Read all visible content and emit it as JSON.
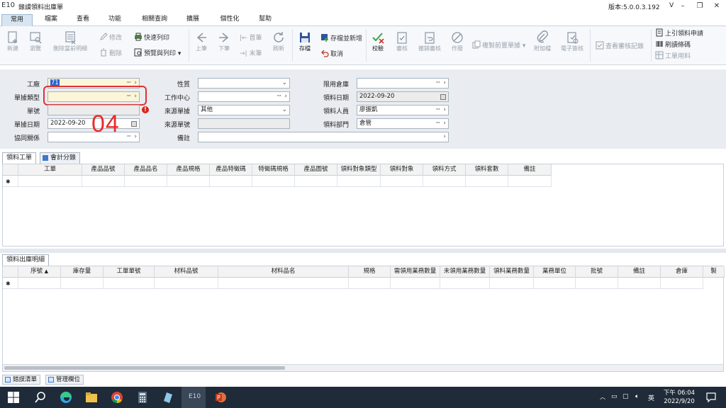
{
  "window": {
    "logo": "E10",
    "title": "錄謨領料出庫單",
    "version": "版本:5.0.0.3.192",
    "version_suffix": "V",
    "controls": [
      "–",
      "❐",
      "✕"
    ]
  },
  "menu": {
    "tabs": [
      "常用",
      "檔案",
      "查看",
      "功能",
      "相關查詢",
      "擴展",
      "個性化",
      "幫助"
    ],
    "active": "常用"
  },
  "ribbon": {
    "new": "新建",
    "browse": "瀏覽",
    "delete_detail": "刪除當前明細",
    "modify": "修改",
    "delete": "刪除",
    "quick_print": "快速列印",
    "preview_print": "預覽與列印",
    "prev": "上筆",
    "next": "下筆",
    "first": "首筆",
    "last": "末筆",
    "refresh": "刷新",
    "save": "存檔",
    "save_new": "存檔並新增",
    "cancel": "取消",
    "verify": "校驗",
    "approve": "審核",
    "unapprove": "撤銷審核",
    "void": "作廢",
    "copy_prev": "複製前置單據",
    "attachment": "附加檔",
    "e_sign": "電子簽核",
    "view_sign_log": "查看審核記錄",
    "pull_request": "上引領料申請",
    "print_barcode": "刷讀條碼",
    "work_order_material": "工單用料"
  },
  "form": {
    "labels": {
      "factory": "工廠",
      "doc_type": "單據類型",
      "doc_no": "單號",
      "doc_date": "單據日期",
      "relation": "協同關係",
      "nature": "性質",
      "work_center": "工作中心",
      "source_doc": "來源單據",
      "source_no": "來源單號",
      "remark": "備註",
      "warehouse": "限用倉庫",
      "issue_date": "領料日期",
      "issuer": "領料人員",
      "issue_dept": "領料部門"
    },
    "values": {
      "factory": "71",
      "doc_type": "",
      "doc_no": "",
      "doc_date": "2022-09-20",
      "relation": "",
      "nature": "",
      "work_center": "",
      "source_doc": "其他",
      "source_no": "",
      "remark": "",
      "warehouse": "",
      "issue_date": "2022-09-20",
      "issuer": "廖振凱",
      "issue_dept": "倉管"
    },
    "annotation": "04"
  },
  "upper_tabs": [
    "領料工單",
    "會計分錄"
  ],
  "upper_grid": {
    "columns": [
      "工單",
      "產品品號",
      "產品品名",
      "產品規格",
      "產品特徵碼",
      "特徵碼規格",
      "產品圖號",
      "領料對象類型",
      "領料對象",
      "領料方式",
      "領料套數",
      "備註"
    ]
  },
  "lower_tabs": [
    "領料出庫明細"
  ],
  "lower_grid": {
    "columns": [
      "序號",
      "庫存量",
      "工單單號",
      "材料品號",
      "材料品名",
      "規格",
      "需領用業務數量",
      "未領用業務數量",
      "領料業務數量",
      "業務單位",
      "批號",
      "備註",
      "倉庫",
      "製"
    ]
  },
  "bottom_tabs": [
    "錯誤清單",
    "管理欄位"
  ],
  "taskbar": {
    "tray_lang": "英",
    "time": "下午 06:04",
    "date": "2022/9/20",
    "app_label": "E10"
  }
}
